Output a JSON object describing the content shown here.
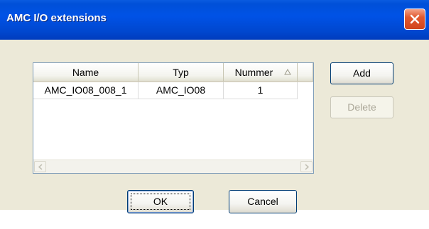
{
  "window": {
    "title": "AMC I/O extensions"
  },
  "list": {
    "columns": [
      {
        "label": "Name"
      },
      {
        "label": "Typ"
      },
      {
        "label": "Nummer"
      }
    ],
    "rows": [
      {
        "name": "AMC_IO08_008_1",
        "typ": "AMC_IO08",
        "nummer": "1"
      }
    ]
  },
  "buttons": {
    "add": "Add",
    "delete": "Delete",
    "ok": "OK",
    "cancel": "Cancel"
  },
  "colors": {
    "title_bar": "#0052e6",
    "dialog_bg": "#ece9d8",
    "close_button": "#e2592f"
  }
}
